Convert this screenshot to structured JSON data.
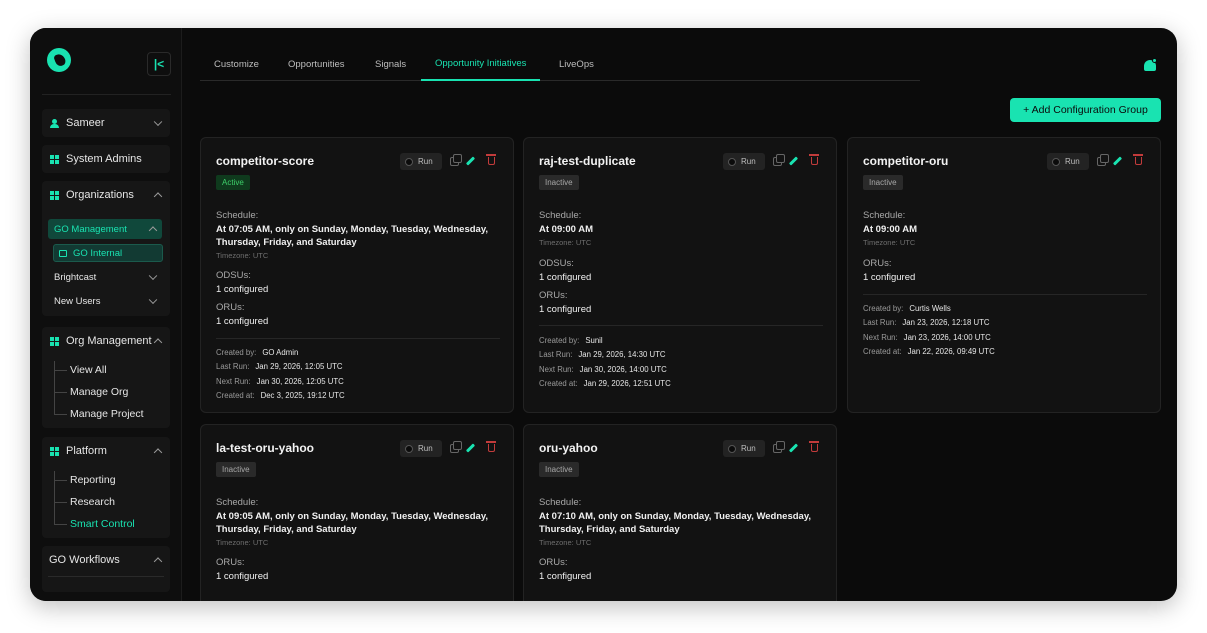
{
  "sidebar": {
    "collapse_glyph": "|<",
    "user": "Sameer",
    "system_admins": "System Admins",
    "organizations": "Organizations",
    "orgs": {
      "go_management": "GO Management",
      "go_internal": "GO Internal",
      "brightcast": "Brightcast",
      "new_users": "New Users"
    },
    "org_management": {
      "label": "Org Management",
      "items": [
        "View All",
        "Manage Org",
        "Manage Project"
      ]
    },
    "platform": {
      "label": "Platform",
      "items": [
        "Reporting",
        "Research",
        "Smart Control"
      ]
    },
    "go_workflows": "GO Workflows"
  },
  "tabs": [
    "Customize",
    "Opportunities",
    "Signals",
    "Opportunity Initiatives",
    "LiveOps"
  ],
  "active_tab": "Opportunity Initiatives",
  "add_button": "+ Add Configuration Group",
  "run_label": "Run",
  "labels": {
    "schedule": "Schedule:",
    "odsus": "ODSUs:",
    "orus": "ORUs:",
    "created_by": "Created by:",
    "last_run": "Last Run:",
    "next_run": "Next Run:",
    "created_at": "Created at:"
  },
  "cards": [
    {
      "title": "competitor-score",
      "status": "Active",
      "schedule": "At 07:05 AM, only on Sunday, Monday, Tuesday, Wednesday, Thursday, Friday, and Saturday",
      "timezone": "Timezone: UTC",
      "odsus": "1 configured",
      "orus": "1 configured",
      "created_by": "GO Admin",
      "last_run": "Jan 29, 2026, 12:05 UTC",
      "next_run": "Jan 30, 2026, 12:05 UTC",
      "created_at": "Dec 3, 2025, 19:12 UTC"
    },
    {
      "title": "raj-test-duplicate",
      "status": "Inactive",
      "schedule": "At 09:00 AM",
      "timezone": "Timezone: UTC",
      "odsus": "1 configured",
      "orus": "1 configured",
      "created_by": "Sunil",
      "last_run": "Jan 29, 2026, 14:30 UTC",
      "next_run": "Jan 30, 2026, 14:00 UTC",
      "created_at": "Jan 29, 2026, 12:51 UTC"
    },
    {
      "title": "competitor-oru",
      "status": "Inactive",
      "schedule": "At 09:00 AM",
      "timezone": "Timezone: UTC",
      "orus": "1 configured",
      "created_by": "Curtis Wells",
      "last_run": "Jan 23, 2026, 12:18 UTC",
      "next_run": "Jan 23, 2026, 14:00 UTC",
      "created_at": "Jan 22, 2026, 09:49 UTC"
    },
    {
      "title": "la-test-oru-yahoo",
      "status": "Inactive",
      "schedule": "At 09:05 AM, only on Sunday, Monday, Tuesday, Wednesday, Thursday, Friday, and Saturday",
      "timezone": "Timezone: UTC",
      "orus": "1 configured"
    },
    {
      "title": "oru-yahoo",
      "status": "Inactive",
      "schedule": "At 07:10 AM, only on Sunday, Monday, Tuesday, Wednesday, Thursday, Friday, and Saturday",
      "timezone": "Timezone: UTC",
      "orus": "1 configured"
    }
  ],
  "colors": {
    "accent": "#19e3b1",
    "background": "#0b0b0b",
    "card": "#121212",
    "danger": "#c23b3b",
    "active_status": "#3ecf6a"
  }
}
